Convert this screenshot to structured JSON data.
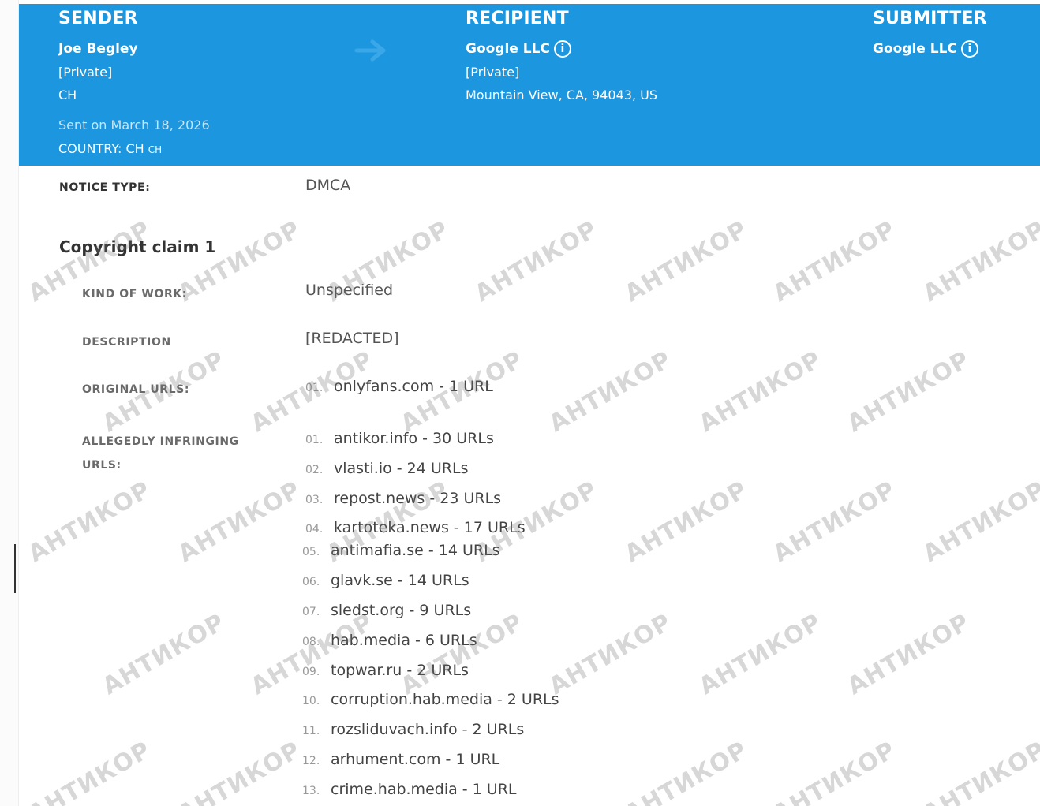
{
  "sender": {
    "title": "SENDER",
    "name": "Joe Begley",
    "line1": "[Private]",
    "line2": "CH",
    "sent": "Sent on March 18, 2026",
    "country_label": "COUNTRY: CH",
    "country_code": "CH"
  },
  "recipient": {
    "title": "RECIPIENT",
    "name": "Google LLC",
    "line1": "[Private]",
    "line2": "Mountain View, CA, 94043, US"
  },
  "submitter": {
    "title": "SUBMITTER",
    "name": "Google LLC"
  },
  "notice": {
    "type_label": "NOTICE TYPE:",
    "type_value": "DMCA"
  },
  "claim": {
    "title": "Copyright claim 1",
    "kind_label": "KIND OF WORK:",
    "kind_value": "Unspecified",
    "description_label": "DESCRIPTION",
    "description_value": "[REDACTED]",
    "original_label": "ORIGINAL URLS:",
    "original_urls": [
      {
        "num": "01.",
        "text": "onlyfans.com - 1 URL"
      }
    ],
    "infringing_label_1": "ALLEGEDLY INFRINGING",
    "infringing_label_2": "URLS:",
    "infringing_urls": [
      {
        "num": "01.",
        "text": "antikor.info - 30 URLs"
      },
      {
        "num": "02.",
        "text": "vlasti.io - 24 URLs"
      },
      {
        "num": "03.",
        "text": "repost.news - 23 URLs"
      },
      {
        "num": "04.",
        "text": "kartoteka.news - 17 URLs"
      },
      {
        "num": "05.",
        "text": "antimafia.se - 14 URLs"
      },
      {
        "num": "06.",
        "text": "glavk.se - 14 URLs"
      },
      {
        "num": "07.",
        "text": "sledst.org - 9 URLs"
      },
      {
        "num": "08.",
        "text": "hab.media - 6 URLs"
      },
      {
        "num": "09.",
        "text": "topwar.ru - 2 URLs"
      },
      {
        "num": "10.",
        "text": "corruption.hab.media - 2 URLs"
      },
      {
        "num": "11.",
        "text": "rozsliduvach.info - 2 URLs"
      },
      {
        "num": "12.",
        "text": "arhument.com - 1 URL"
      },
      {
        "num": "13.",
        "text": "crime.hab.media - 1 URL"
      }
    ]
  },
  "watermark": "АНТИКОР",
  "colors": {
    "header_bg": "#1c96de",
    "header_text": "#ffffff"
  },
  "icons": {
    "info": "info-icon",
    "arrow": "arrow-right-icon"
  }
}
